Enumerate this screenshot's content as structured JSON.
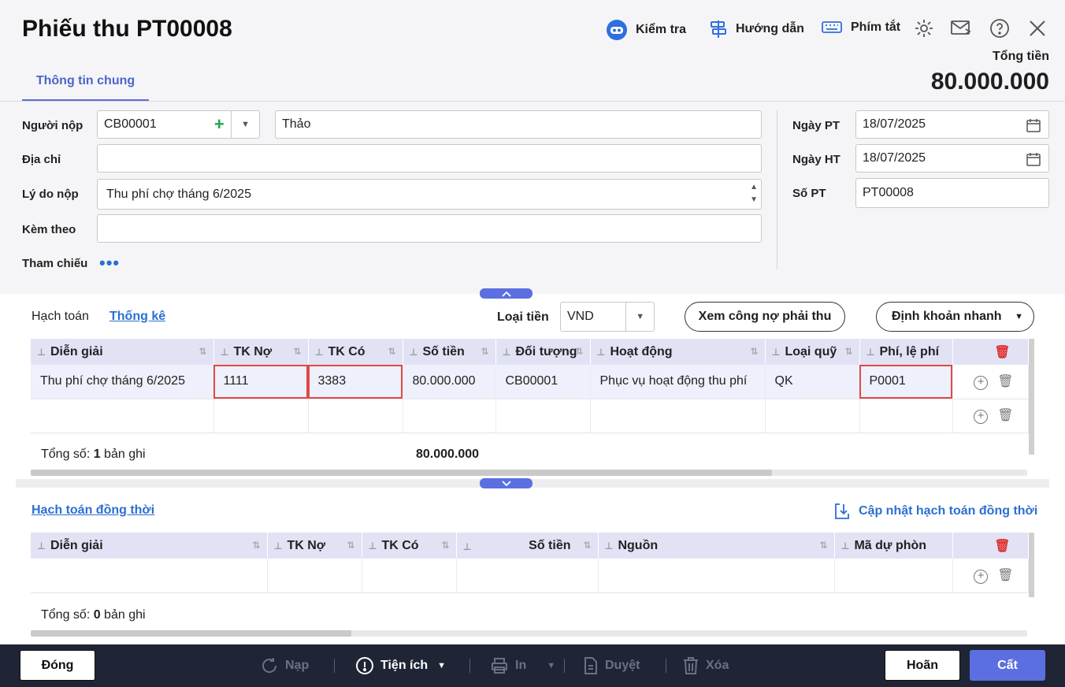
{
  "header": {
    "title": "Phiếu thu PT00008",
    "tools": [
      {
        "label": "Kiểm tra",
        "icon": "robot-icon"
      },
      {
        "label": "Hướng dẫn",
        "icon": "signpost-icon"
      },
      {
        "label": "Phím tắt",
        "icon": "keyboard-icon"
      }
    ],
    "total_label": "Tổng tiền",
    "total_value": "80.000.000"
  },
  "tabs": {
    "general": "Thông tin chung"
  },
  "form": {
    "payer_label": "Người nộp",
    "payer_code": "CB00001",
    "payer_name": "Thảo",
    "address_label": "Địa chỉ",
    "address_value": "",
    "reason_label": "Lý do nộp",
    "reason_value": "Thu phí chợ tháng 6/2025",
    "attach_label": "Kèm theo",
    "attach_value": "",
    "ref_label": "Tham chiếu",
    "date_pt_label": "Ngày PT",
    "date_pt": "18/07/2025",
    "date_ht_label": "Ngày HT",
    "date_ht": "18/07/2025",
    "so_pt_label": "Số PT",
    "so_pt": "PT00008"
  },
  "detail": {
    "tab_accounting": "Hạch toán",
    "tab_stats": "Thống kê",
    "currency_label": "Loại tiền",
    "currency": "VND",
    "debt_button": "Xem công nợ phải thu",
    "quick_button": "Định khoản nhanh",
    "columns": [
      "Diễn giải",
      "TK Nợ",
      "TK Có",
      "Số tiền",
      "Đối tượng",
      "Hoạt động",
      "Loại quỹ",
      "Phí, lệ phí"
    ],
    "rows": [
      {
        "desc": "Thu phí chợ tháng 6/2025",
        "debit": "1111",
        "credit": "3383",
        "amount": "80.000.000",
        "object": "CB00001",
        "activity": "Phục vụ hoạt động thu phí",
        "fund": "QK",
        "fee": "P0001"
      }
    ],
    "total_prefix": "Tổng số: ",
    "total_count": "1",
    "total_suffix": " bản ghi",
    "total_amount": "80.000.000"
  },
  "concurrent": {
    "title": "Hạch toán đồng thời",
    "update_button": "Cập nhật hạch toán đồng thời",
    "columns": [
      "Diễn giải",
      "TK Nợ",
      "TK Có",
      "Số tiền",
      "Nguồn",
      "Mã dự phòn"
    ],
    "total_prefix": "Tổng số: ",
    "total_count": "0",
    "total_suffix": " bản ghi"
  },
  "footer": {
    "close": "Đóng",
    "reload": "Nạp",
    "utilities": "Tiện ích",
    "print": "In",
    "approve": "Duyệt",
    "delete": "Xóa",
    "cancel": "Hoãn",
    "save": "Cất"
  },
  "colors": {
    "accent": "#5b6fe0",
    "highlight": "#e04848",
    "footer": "#1f2535",
    "link": "#2b6fd1"
  }
}
